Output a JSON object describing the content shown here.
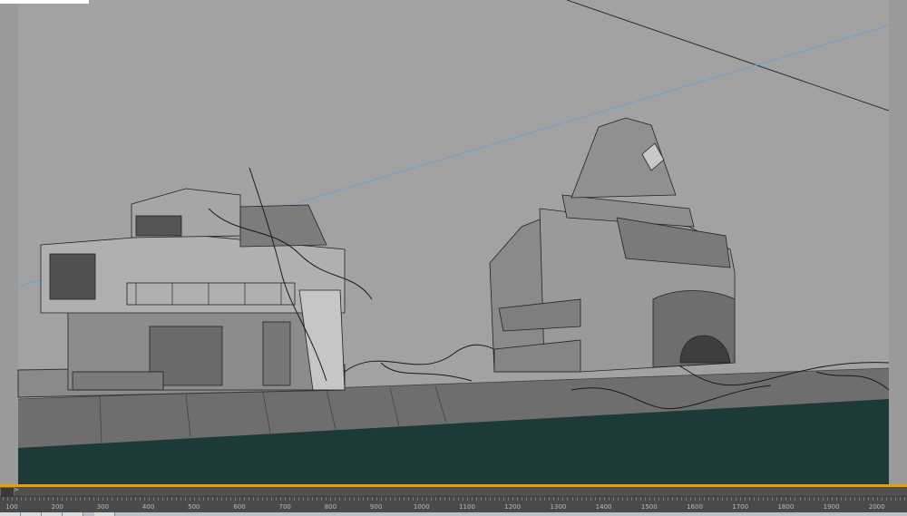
{
  "app": "3D viewport",
  "viewport": {
    "background_color": "#a2a2a2",
    "ground_color": "#1d3a3b",
    "selection_border_color": "#d9a11f"
  },
  "timeslider": {
    "next_label": ">"
  },
  "trackbar": {
    "labels": [
      "100",
      "200",
      "300",
      "400",
      "500",
      "600",
      "700",
      "800",
      "900",
      "1000",
      "1100",
      "1200",
      "1300",
      "1400",
      "1500",
      "1600",
      "1700",
      "1800",
      "1900",
      "2000"
    ]
  }
}
